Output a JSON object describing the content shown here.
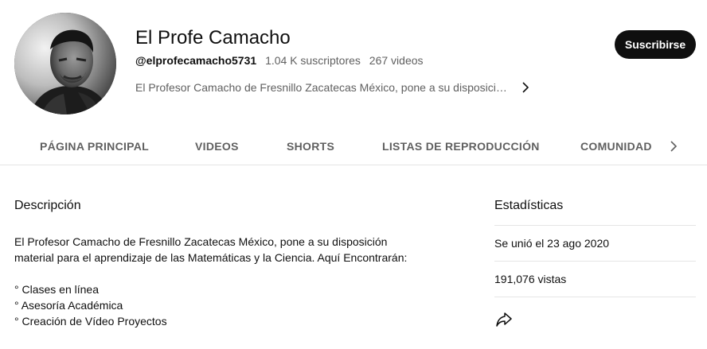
{
  "channel": {
    "name": "El Profe Camacho",
    "handle": "@elprofecamacho5731",
    "subscribers": "1.04 K suscriptores",
    "videos": "267 videos",
    "short_description": "El Profesor Camacho de Fresnillo Zacatecas México, pone a su disposición material para el aprendizaje de las Matemáticas y la Ciencia.",
    "subscribe_label": "Suscribirse",
    "avatar_icon": "avatar-photo"
  },
  "tabs": [
    {
      "label": "PÁGINA PRINCIPAL"
    },
    {
      "label": "VIDEOS"
    },
    {
      "label": "SHORTS"
    },
    {
      "label": "LISTAS DE REPRODUCCIÓN"
    },
    {
      "label": "COMUNIDAD"
    }
  ],
  "about": {
    "description_title": "Descripción",
    "description_lines": [
      "El Profesor Camacho de Fresnillo Zacatecas México, pone a su disposición",
      "material para el aprendizaje de las Matemáticas y la Ciencia. Aquí Encontrarán:",
      "",
      "° Clases en línea",
      "° Asesoría Académica",
      "° Creación de Vídeo Proyectos"
    ],
    "stats_title": "Estadísticas",
    "joined": "Se unió el 23 ago 2020",
    "views": "191,076 vistas"
  },
  "icons": {
    "more": "chevron-right-icon",
    "tabs_next": "chevron-right-icon",
    "share": "share-icon"
  }
}
